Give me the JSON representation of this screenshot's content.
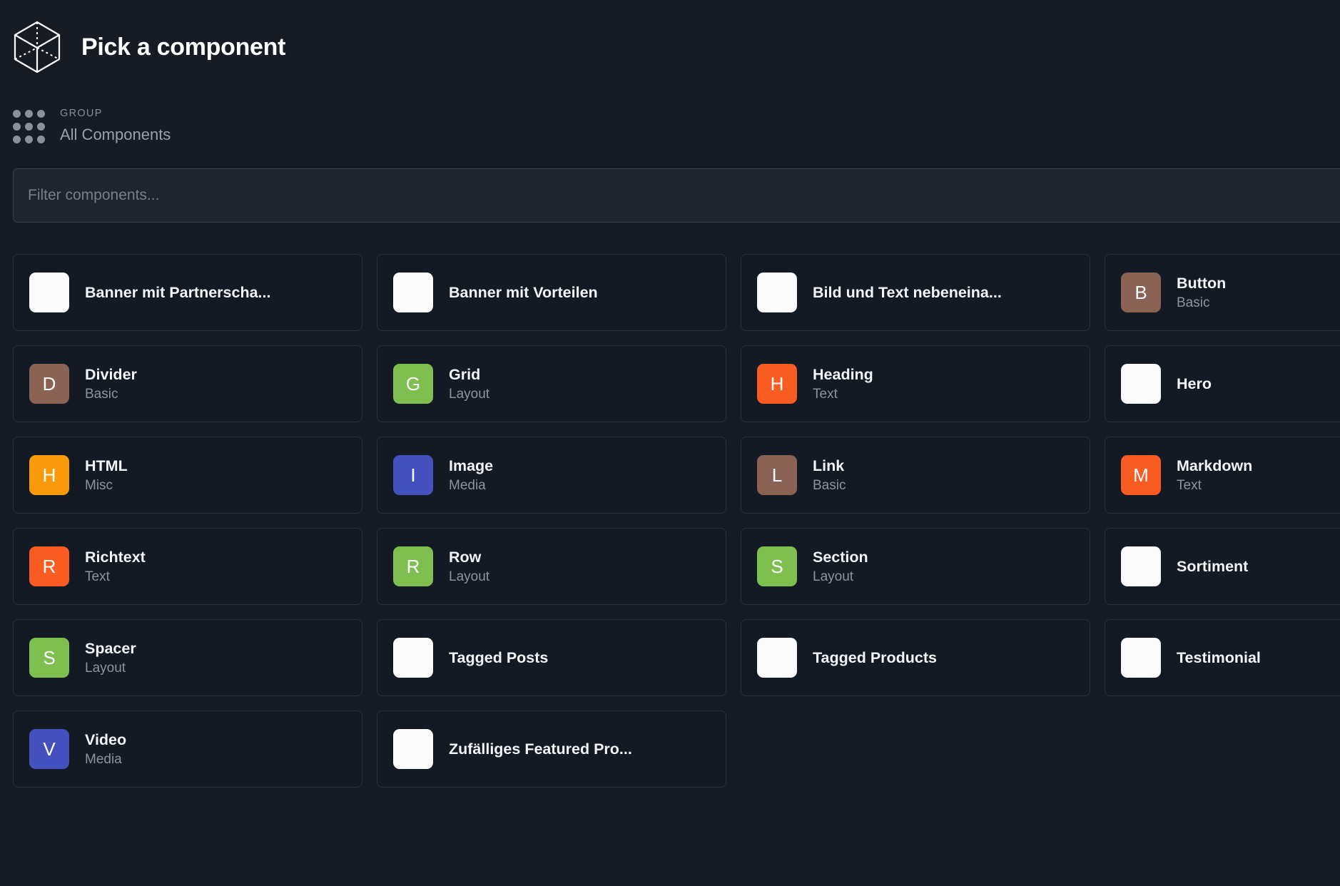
{
  "header": {
    "title": "Pick a component",
    "logo_icon": "wireframe-cube-icon"
  },
  "group": {
    "icon": "dot-grid-icon",
    "label": "GROUP",
    "value": "All Components"
  },
  "search": {
    "placeholder": "Filter components...",
    "value": ""
  },
  "colors": {
    "background": "#161b24",
    "card_bg": "#141a23",
    "card_border": "#2b323d",
    "input_bg": "#1f242e",
    "input_border": "#38404d",
    "brown": "#8a6355",
    "green": "#7fbf4f",
    "orange": "#f85c22",
    "amber": "#f99a0b",
    "indigo": "#4450bd",
    "white": "#fbfbfc"
  },
  "components": [
    {
      "title": "Banner mit Partnerscha...",
      "subtitle": "",
      "initial": "",
      "color": "#fbfbfc"
    },
    {
      "title": "Banner mit Vorteilen",
      "subtitle": "",
      "initial": "",
      "color": "#fbfbfc"
    },
    {
      "title": "Bild und Text nebeneina...",
      "subtitle": "",
      "initial": "",
      "color": "#fbfbfc"
    },
    {
      "title": "Button",
      "subtitle": "Basic",
      "initial": "B",
      "color": "#8a6355"
    },
    {
      "title": "Divider",
      "subtitle": "Basic",
      "initial": "D",
      "color": "#8a6355"
    },
    {
      "title": "Grid",
      "subtitle": "Layout",
      "initial": "G",
      "color": "#7fbf4f"
    },
    {
      "title": "Heading",
      "subtitle": "Text",
      "initial": "H",
      "color": "#f85c22"
    },
    {
      "title": "Hero",
      "subtitle": "",
      "initial": "",
      "color": "#fbfbfc"
    },
    {
      "title": "HTML",
      "subtitle": "Misc",
      "initial": "H",
      "color": "#f99a0b"
    },
    {
      "title": "Image",
      "subtitle": "Media",
      "initial": "I",
      "color": "#4450bd"
    },
    {
      "title": "Link",
      "subtitle": "Basic",
      "initial": "L",
      "color": "#8a6355"
    },
    {
      "title": "Markdown",
      "subtitle": "Text",
      "initial": "M",
      "color": "#f85c22"
    },
    {
      "title": "Richtext",
      "subtitle": "Text",
      "initial": "R",
      "color": "#f85c22"
    },
    {
      "title": "Row",
      "subtitle": "Layout",
      "initial": "R",
      "color": "#7fbf4f"
    },
    {
      "title": "Section",
      "subtitle": "Layout",
      "initial": "S",
      "color": "#7fbf4f"
    },
    {
      "title": "Sortiment",
      "subtitle": "",
      "initial": "",
      "color": "#fbfbfc"
    },
    {
      "title": "Spacer",
      "subtitle": "Layout",
      "initial": "S",
      "color": "#7fbf4f"
    },
    {
      "title": "Tagged Posts",
      "subtitle": "",
      "initial": "",
      "color": "#fbfbfc"
    },
    {
      "title": "Tagged Products",
      "subtitle": "",
      "initial": "",
      "color": "#fbfbfc"
    },
    {
      "title": "Testimonial",
      "subtitle": "",
      "initial": "",
      "color": "#fbfbfc"
    },
    {
      "title": "Video",
      "subtitle": "Media",
      "initial": "V",
      "color": "#4450bd"
    },
    {
      "title": "Zufälliges Featured Pro...",
      "subtitle": "",
      "initial": "",
      "color": "#fbfbfc"
    }
  ]
}
